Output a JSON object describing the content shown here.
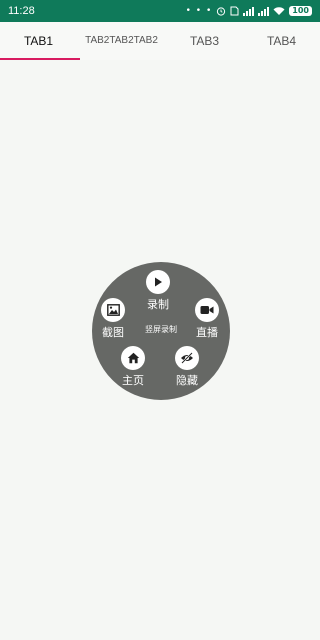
{
  "status_bar": {
    "time": "11:28",
    "indicators": "• • • ⏰ ✈",
    "battery": "100"
  },
  "tabs": [
    {
      "label": "TAB1",
      "active": true
    },
    {
      "label": "TAB2TAB2TAB2",
      "active": false
    },
    {
      "label": "TAB3",
      "active": false
    },
    {
      "label": "TAB4",
      "active": false
    }
  ],
  "float_menu": {
    "center_label": "竖屏录制",
    "items": {
      "record": {
        "label": "录制",
        "icon": "play-icon"
      },
      "screenshot": {
        "label": "截图",
        "icon": "image-icon"
      },
      "live": {
        "label": "直播",
        "icon": "video-camera-icon"
      },
      "home": {
        "label": "主页",
        "icon": "home-icon"
      },
      "hide": {
        "label": "隐藏",
        "icon": "eye-off-icon"
      }
    }
  },
  "colors": {
    "status_bar": "#0f7a5a",
    "tab_indicator": "#d81b60",
    "menu_background": "#666865"
  }
}
